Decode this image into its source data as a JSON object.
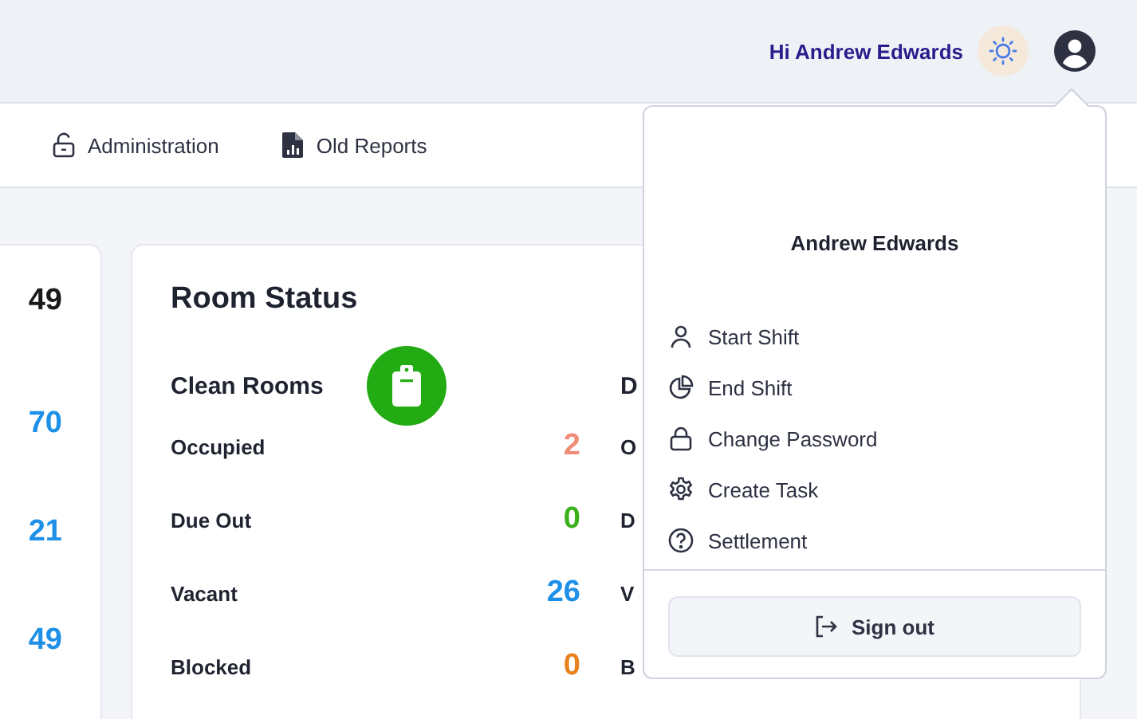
{
  "header": {
    "greeting": "Hi Andrew Edwards"
  },
  "nav": [
    {
      "label": "Administration"
    },
    {
      "label": "Old Reports"
    }
  ],
  "summary_card": {
    "values": [
      {
        "text": "49",
        "color": "#1a1a1a"
      },
      {
        "text": "70",
        "color": "#1e90e8"
      },
      {
        "text": "21",
        "color": "#1e90e8"
      },
      {
        "text": "49",
        "color": "#1e90e8"
      }
    ]
  },
  "room_status": {
    "title": "Room Status",
    "columns": [
      {
        "heading": "Clean Rooms",
        "rows": [
          {
            "label": "Occupied",
            "value": "2",
            "color": "#f08c7a"
          },
          {
            "label": "Due Out",
            "value": "0",
            "color": "#3ab01a"
          },
          {
            "label": "Vacant",
            "value": "26",
            "color": "#1e90e8"
          },
          {
            "label": "Blocked",
            "value": "0",
            "color": "#e8821e"
          }
        ]
      },
      {
        "heading": "D",
        "rows": [
          {
            "label": "O"
          },
          {
            "label": "D"
          },
          {
            "label": "V"
          },
          {
            "label": "B"
          }
        ]
      }
    ]
  },
  "user_menu": {
    "name": "Andrew Edwards",
    "items": [
      {
        "label": "Start Shift"
      },
      {
        "label": "End Shift"
      },
      {
        "label": "Change Password"
      },
      {
        "label": "Create Task"
      },
      {
        "label": "Settlement"
      }
    ],
    "sign_out": "Sign out"
  }
}
